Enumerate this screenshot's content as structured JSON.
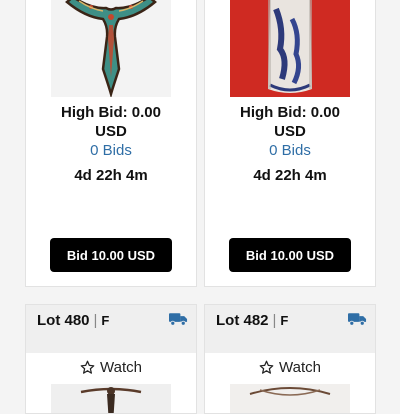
{
  "colors": {
    "bid_button_bg": "#000000",
    "bid_count_link": "#2f6ea6",
    "shipping_icon": "#2f6ea6"
  },
  "lots_top": [
    {
      "high_bid": "High Bid: 0.00",
      "currency": "USD",
      "bids": "0 Bids",
      "time_left": "4d 22h 4m",
      "bid_button": "Bid 10.00 USD",
      "image": "enamel-cross-pendant"
    },
    {
      "high_bid": "High Bid: 0.00",
      "currency": "USD",
      "bids": "0 Bids",
      "time_left": "4d 22h 4m",
      "bid_button": "Bid 10.00 USD",
      "image": "blue-white-vase"
    }
  ],
  "lots_bottom": [
    {
      "lot": "Lot 480",
      "status": "F",
      "watch": "Watch",
      "shipping_icon": "truck-icon",
      "image": "dark-pendant"
    },
    {
      "lot": "Lot 482",
      "status": "F",
      "watch": "Watch",
      "shipping_icon": "truck-icon",
      "image": "cord-necklace"
    }
  ]
}
